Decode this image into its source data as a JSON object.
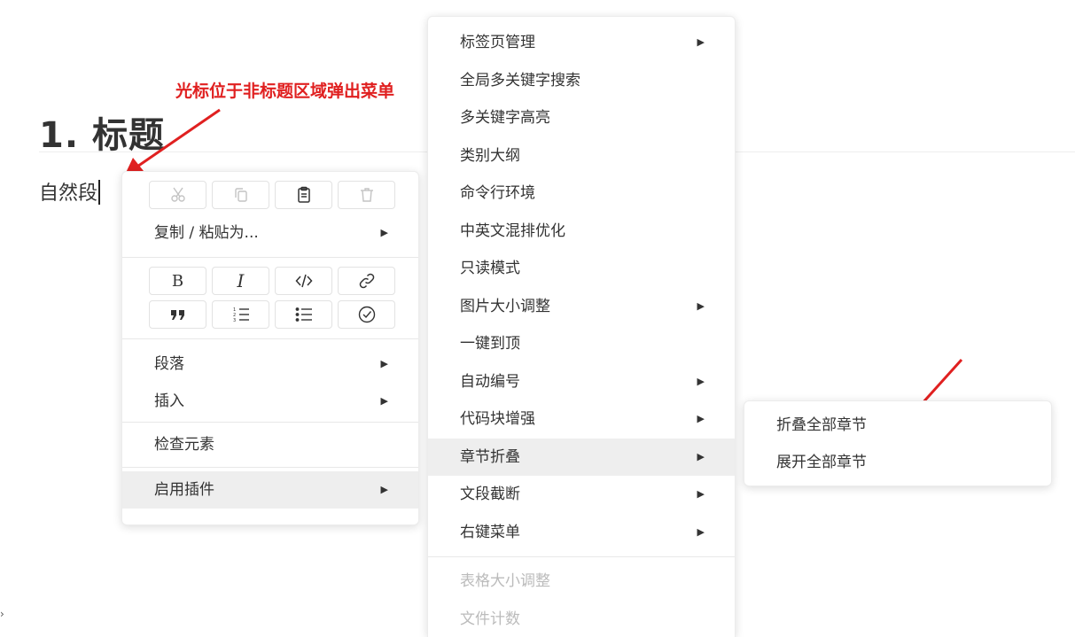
{
  "editor": {
    "heading": "1. 标题",
    "paragraph": "自然段",
    "annotation": "光标位于非标题区域弹出菜单"
  },
  "context_menu": {
    "edit_icons": [
      {
        "name": "cut-icon",
        "enabled": false
      },
      {
        "name": "copy-icon",
        "enabled": false
      },
      {
        "name": "paste-icon",
        "enabled": true
      },
      {
        "name": "delete-icon",
        "enabled": false
      }
    ],
    "copy_paste_as": "复制 / 粘贴为...",
    "format_icons_row1": [
      "bold-icon",
      "italic-icon",
      "code-icon",
      "link-icon"
    ],
    "format_icons_row2": [
      "quote-icon",
      "ordered-list-icon",
      "unordered-list-icon",
      "task-list-icon"
    ],
    "format_glyphs": {
      "bold": "B",
      "italic": "I"
    },
    "paragraph": "段落",
    "insert": "插入",
    "inspect": "检查元素",
    "enable_plugins": "启用插件"
  },
  "plugin_menu": {
    "items": [
      {
        "label": "标签页管理",
        "submenu": true
      },
      {
        "label": "全局多关键字搜索",
        "submenu": false
      },
      {
        "label": "多关键字高亮",
        "submenu": false
      },
      {
        "label": "类别大纲",
        "submenu": false
      },
      {
        "label": "命令行环境",
        "submenu": false
      },
      {
        "label": "中英文混排优化",
        "submenu": false
      },
      {
        "label": "只读模式",
        "submenu": false
      },
      {
        "label": "图片大小调整",
        "submenu": true
      },
      {
        "label": "一键到顶",
        "submenu": false
      },
      {
        "label": "自动编号",
        "submenu": true
      },
      {
        "label": "代码块增强",
        "submenu": true
      },
      {
        "label": "章节折叠",
        "submenu": true,
        "active": true
      },
      {
        "label": "文段截断",
        "submenu": true
      },
      {
        "label": "右键菜单",
        "submenu": true
      }
    ],
    "disabled_items": [
      "表格大小调整",
      "文件计数"
    ]
  },
  "fold_submenu": {
    "collapse_all": "折叠全部章节",
    "expand_all": "展开全部章节"
  },
  "colors": {
    "annotation": "#e02020",
    "active_item_bg": "#eeeeee",
    "disabled_text": "#bbbbbb"
  }
}
